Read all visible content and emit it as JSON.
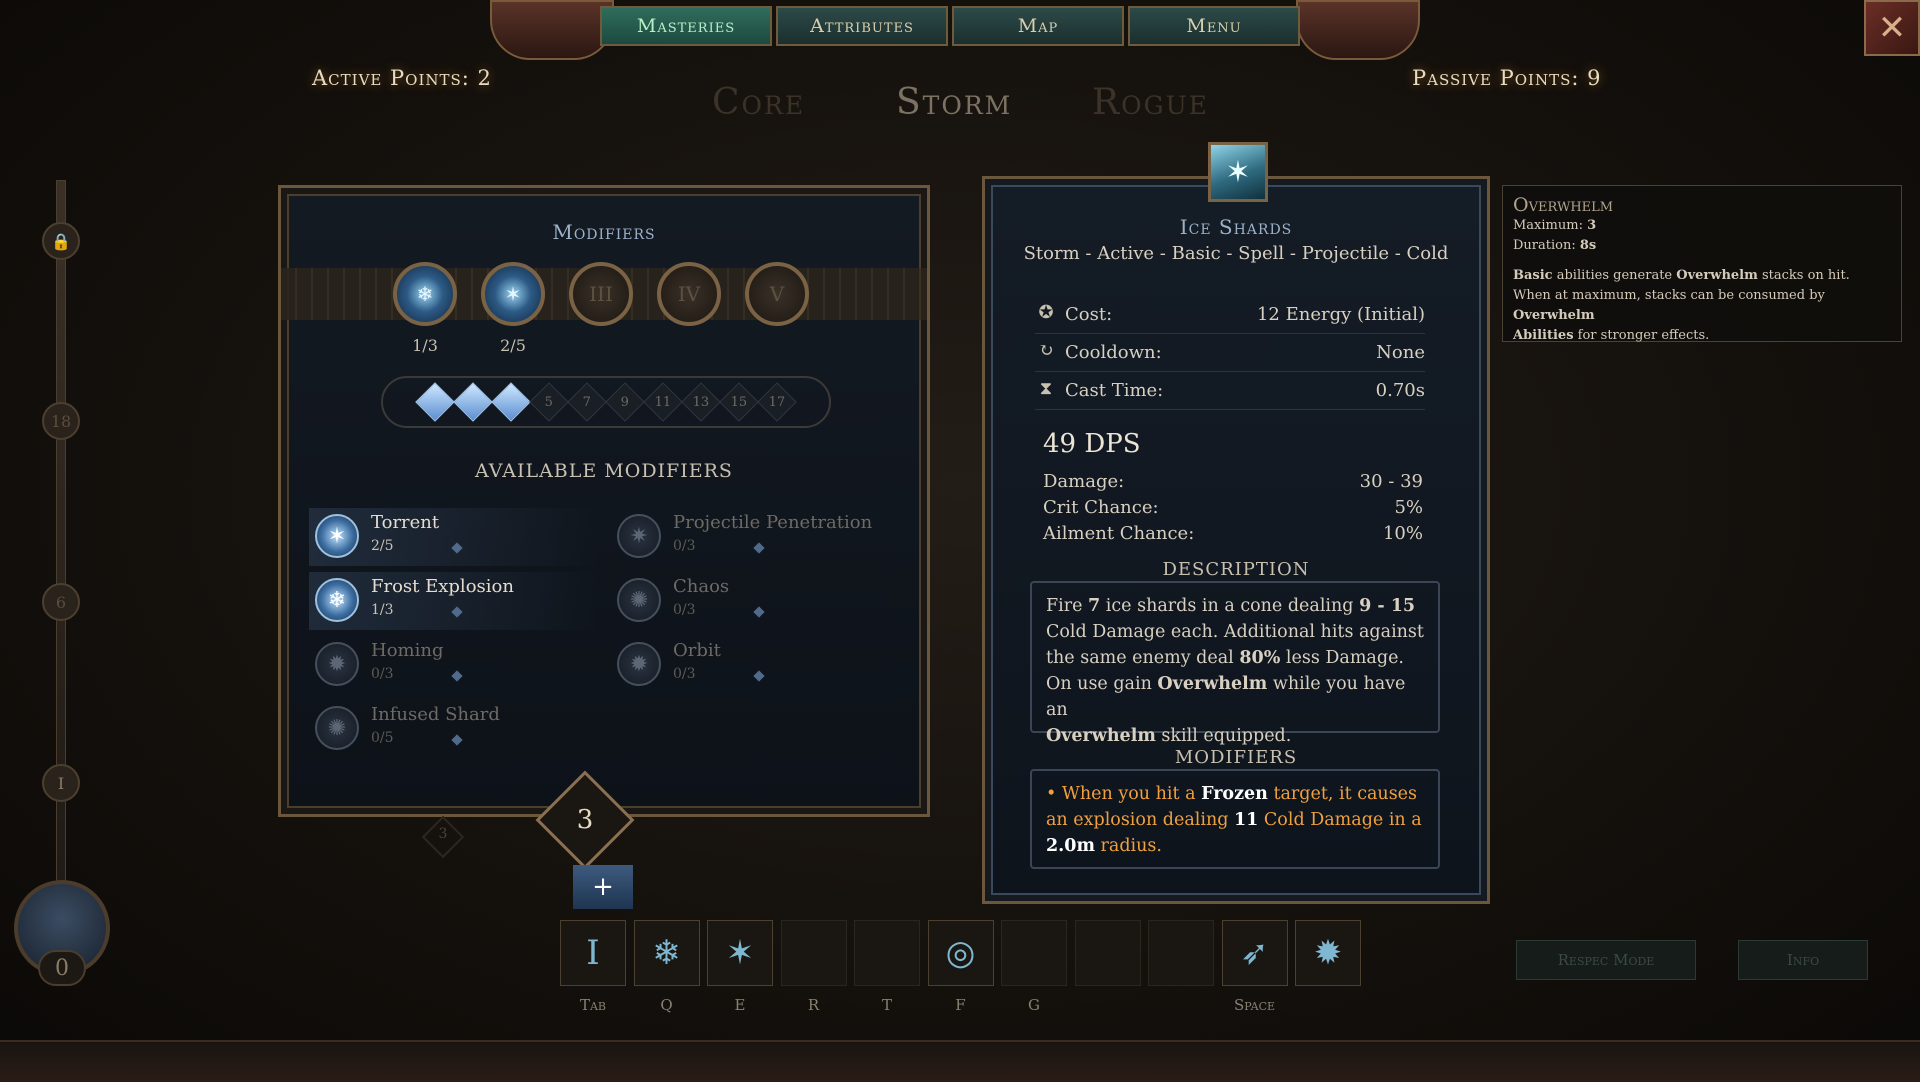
{
  "nav": {
    "tabs": [
      "Masteries",
      "Attributes",
      "Map",
      "Menu"
    ],
    "active_tab": "Masteries"
  },
  "points": {
    "active": "Active Points: 2",
    "passive": "Passive Points: 9"
  },
  "mastery_tabs": {
    "core": "Core",
    "storm": "Storm",
    "rogue": "Rogue",
    "active": "Storm"
  },
  "side_levels": [
    "18",
    "6",
    "I"
  ],
  "level_indicator": "0",
  "modifiers_panel": {
    "title": "Modifiers",
    "slots": [
      {
        "label": "",
        "count": "1/3",
        "icon": "ice-rune-icon",
        "filled": true
      },
      {
        "label": "",
        "count": "2/5",
        "icon": "ice-shards-icon",
        "filled": true
      },
      {
        "label": "III",
        "count": "",
        "filled": false
      },
      {
        "label": "IV",
        "count": "",
        "filled": false
      },
      {
        "label": "V",
        "count": "",
        "filled": false
      }
    ],
    "pips": [
      {
        "label": "",
        "on": true
      },
      {
        "label": "",
        "on": true
      },
      {
        "label": "",
        "on": true
      },
      {
        "label": "5",
        "on": false
      },
      {
        "label": "7",
        "on": false
      },
      {
        "label": "9",
        "on": false
      },
      {
        "label": "11",
        "on": false
      },
      {
        "label": "13",
        "on": false
      },
      {
        "label": "15",
        "on": false
      },
      {
        "label": "17",
        "on": false
      }
    ],
    "available_heading": "AVAILABLE MODIFIERS",
    "items": [
      {
        "name": "Torrent",
        "rank": "2/5",
        "active": true
      },
      {
        "name": "Projectile Penetration",
        "rank": "0/3",
        "active": false
      },
      {
        "name": "Frost Explosion",
        "rank": "1/3",
        "active": true
      },
      {
        "name": "Chaos",
        "rank": "0/3",
        "active": false
      },
      {
        "name": "Homing",
        "rank": "0/3",
        "active": false
      },
      {
        "name": "Orbit",
        "rank": "0/3",
        "active": false
      },
      {
        "name": "Infused Shard",
        "rank": "0/5",
        "active": false
      }
    ],
    "available_points": "3",
    "small_marker": "3",
    "plus": "+"
  },
  "skill": {
    "name": "Ice Shards",
    "tags": "Storm - Active - Basic - Spell - Projectile - Cold",
    "stats": [
      {
        "icon": "energy-icon",
        "glyph": "✪",
        "label": "Cost:",
        "value": "12 Energy (Initial)"
      },
      {
        "icon": "cooldown-icon",
        "glyph": "↻",
        "label": "Cooldown:",
        "value": "None"
      },
      {
        "icon": "hourglass-icon",
        "glyph": "⧗",
        "label": "Cast Time:",
        "value": "0.70s"
      }
    ],
    "dps": "49 DPS",
    "damage_rows": [
      {
        "label": "Damage:",
        "value": "30 - 39"
      },
      {
        "label": "Crit Chance:",
        "value": "5%"
      },
      {
        "label": "Ailment Chance:",
        "value": "10%"
      }
    ],
    "description_heading": "DESCRIPTION",
    "description": {
      "p1": "Fire ",
      "n1": "7",
      "p2": " ice shards in a cone dealing ",
      "n2": "9 - 15",
      "p3": " Cold Damage each. Additional hits against the same enemy deal ",
      "n3": "80%",
      "p4": " less Damage.",
      "p5": "On use gain ",
      "b1": "Overwhelm",
      "p6": " while you have an ",
      "b2": "Overwhelm",
      "p7": " skill equipped."
    },
    "modifiers_heading": "MODIFIERS",
    "modifier_text": {
      "bullet": "•",
      "a": "When you hit a ",
      "b": "Frozen",
      "c": " target, it causes an explosion dealing ",
      "d": "11",
      "e": " Cold Damage in a ",
      "f": "2.0m",
      "g": " radius."
    }
  },
  "tooltip": {
    "title": "Overwhelm",
    "max_label": "Maximum: ",
    "max_value": "3",
    "dur_label": "Duration: ",
    "dur_value": "8s",
    "l1a": "Basic",
    "l1b": " abilities generate ",
    "l1c": "Overwhelm",
    "l1d": " stacks on hit.",
    "l2a": "When at maximum, stacks can be consumed by ",
    "l2b": "Overwhelm",
    "l3a": "Abilities",
    "l3b": " for stronger effects."
  },
  "hotbar": {
    "slots": [
      {
        "key": "Tab",
        "glyph": "Ⅰ",
        "filled": true
      },
      {
        "key": "Q",
        "glyph": "❄",
        "filled": true
      },
      {
        "key": "E",
        "glyph": "✶",
        "filled": true
      },
      {
        "key": "R",
        "glyph": "",
        "filled": false
      },
      {
        "key": "T",
        "glyph": "",
        "filled": false
      },
      {
        "key": "F",
        "glyph": "◎",
        "filled": true
      },
      {
        "key": "G",
        "glyph": "",
        "filled": false
      },
      {
        "key": "",
        "glyph": "",
        "filled": false
      },
      {
        "key": "",
        "glyph": "",
        "filled": false
      },
      {
        "key": "Space",
        "glyph": "➶",
        "filled": true
      },
      {
        "key": "",
        "glyph": "✹",
        "filled": true
      }
    ],
    "respec": "Respec Mode",
    "info": "Info"
  },
  "colors": {
    "accent": "#f0a040",
    "ice": "#9ad4f0",
    "gold": "#c9a36a"
  }
}
